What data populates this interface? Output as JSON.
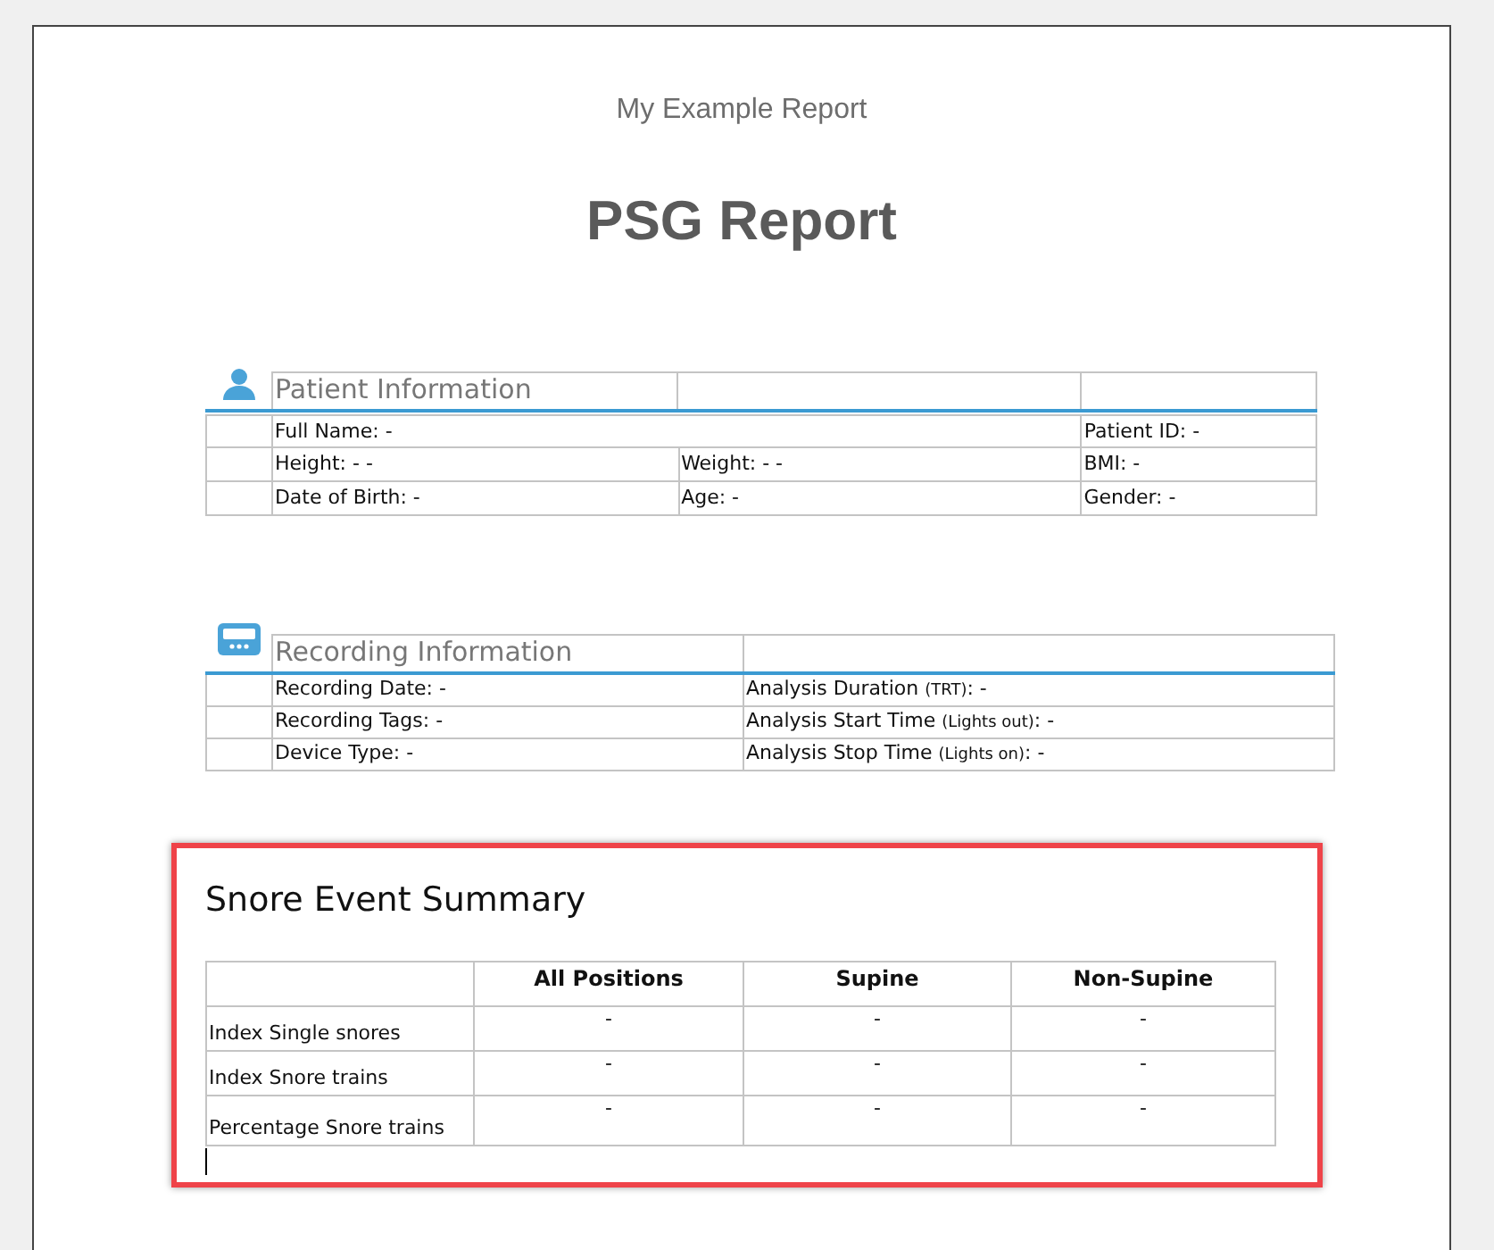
{
  "header": {
    "subtitle": "My Example Report",
    "title": "PSG Report"
  },
  "patient_information": {
    "title": "Patient Information",
    "rows": [
      {
        "cells": [
          "Full Name: -",
          "",
          "Patient ID: -"
        ]
      },
      {
        "cells": [
          "Height: - -",
          "Weight: - -",
          "BMI: -"
        ]
      },
      {
        "cells": [
          "Date of Birth: -",
          "Age: -",
          "Gender: -"
        ]
      }
    ]
  },
  "recording_information": {
    "title": "Recording Information",
    "rows": [
      [
        {
          "text": "Recording Date: -"
        },
        {
          "text": "Analysis Duration",
          "note": "(TRT)",
          "tail": ": -"
        }
      ],
      [
        {
          "text": "Recording Tags: -"
        },
        {
          "text": "Analysis Start Time",
          "note": "(Lights out)",
          "tail": ": -"
        }
      ],
      [
        {
          "text": "Device Type: -"
        },
        {
          "text": "Analysis Stop Time",
          "note": "(Lights on)",
          "tail": ": -"
        }
      ]
    ]
  },
  "snore_event_summary": {
    "title": "Snore Event Summary",
    "highlighted": true,
    "columns": [
      "All Positions",
      "Supine",
      "Non-Supine"
    ],
    "rows": [
      {
        "label": "Index Single snores",
        "values": [
          "-",
          "-",
          "-"
        ]
      },
      {
        "label": "Index Snore trains",
        "values": [
          "-",
          "-",
          "-"
        ]
      },
      {
        "label": "Percentage Snore trains",
        "values": [
          "-",
          "-",
          "-"
        ]
      }
    ]
  }
}
